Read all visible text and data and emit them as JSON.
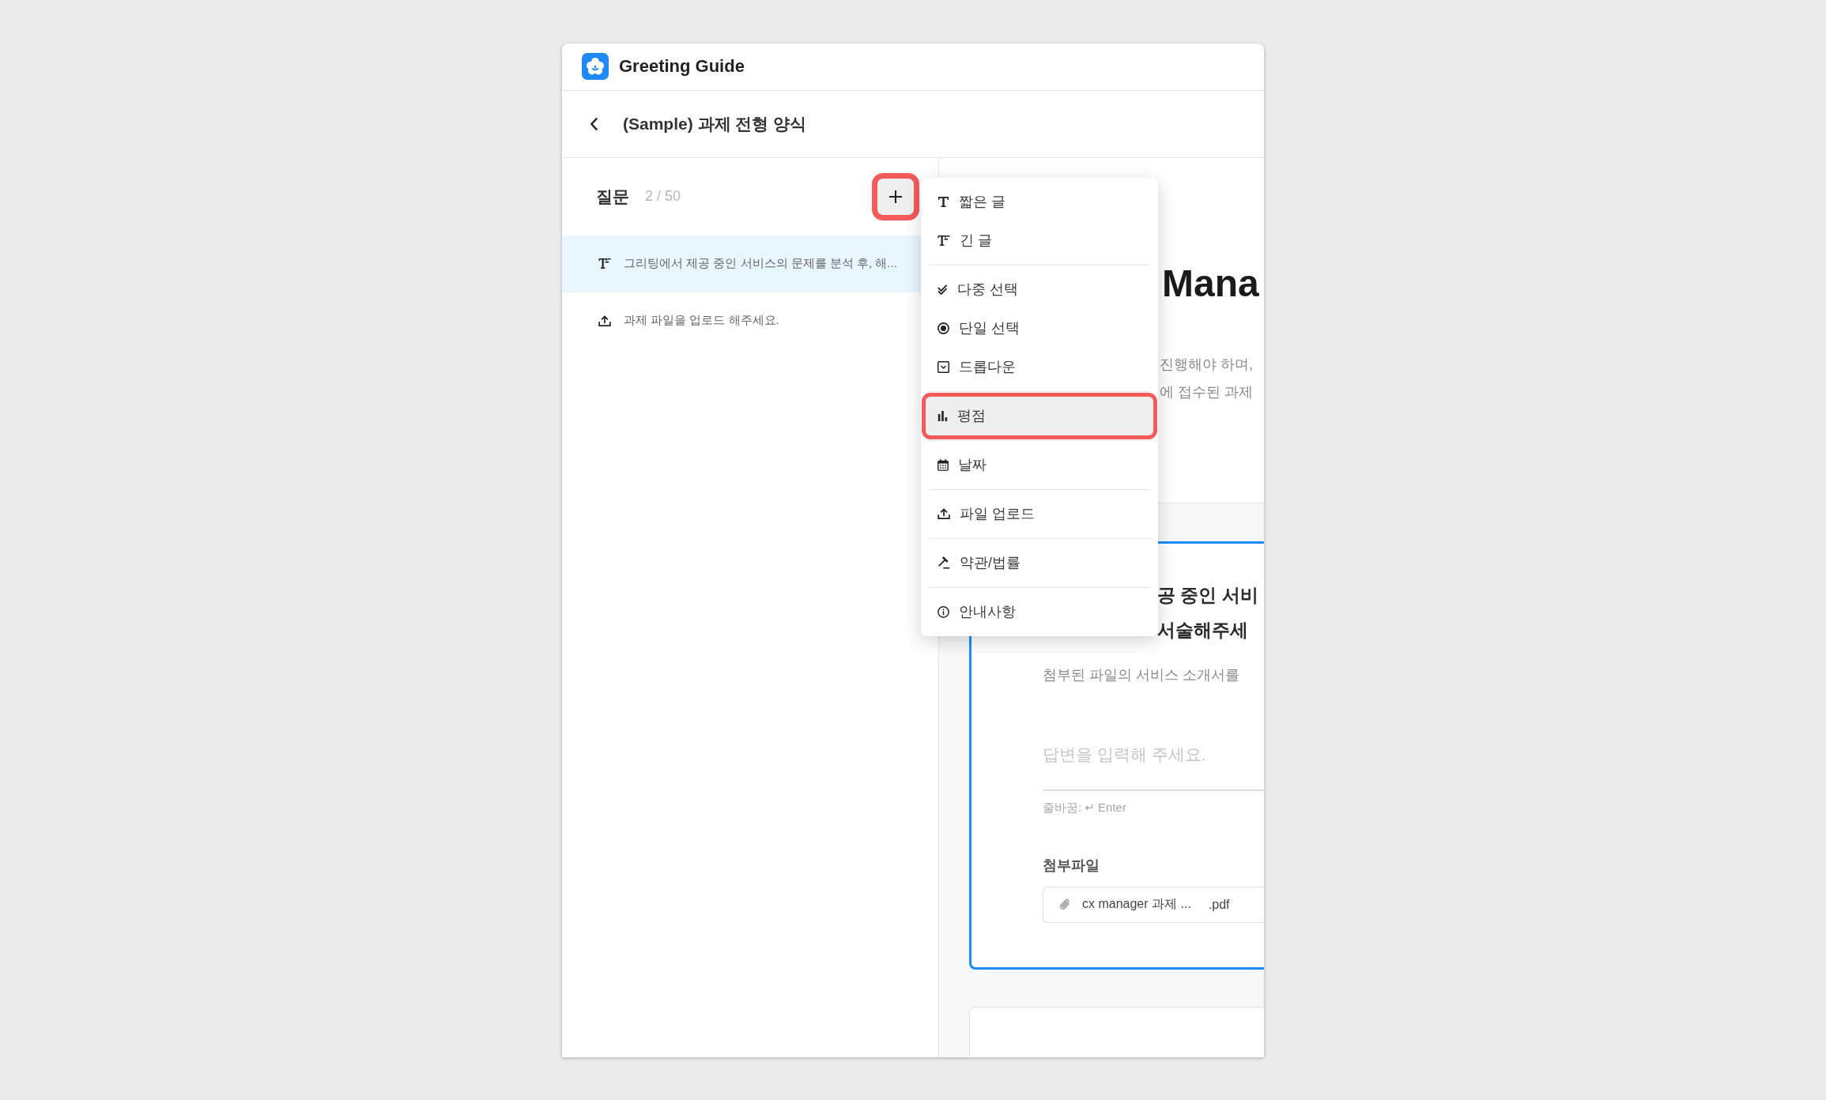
{
  "app": {
    "name": "Greeting Guide"
  },
  "page_header": {
    "title": "(Sample) 과제 전형 양식"
  },
  "question_panel": {
    "title": "질문",
    "count": "2 / 50",
    "add_button": {
      "highlighted": true
    },
    "questions": [
      {
        "kind": "long_text",
        "text": "그리팅에서 제공 중인 서비스의 문제를 분석 후, 해...",
        "selected": true
      },
      {
        "kind": "file_upload",
        "text": "과제 파일을 업로드 해주세요.",
        "selected": false
      }
    ]
  },
  "add_menu": {
    "groups": [
      {
        "items": [
          {
            "kind": "short_text",
            "label": "짧은 글",
            "highlighted": false
          },
          {
            "kind": "long_text",
            "label": "긴 글",
            "highlighted": false
          }
        ]
      },
      {
        "items": [
          {
            "kind": "multiple_choice",
            "label": "다중 선택",
            "highlighted": false
          },
          {
            "kind": "single_choice",
            "label": "단일 선택",
            "highlighted": false
          },
          {
            "kind": "dropdown",
            "label": "드롭다운",
            "highlighted": false
          }
        ]
      },
      {
        "items": [
          {
            "kind": "rating",
            "label": "평점",
            "highlighted": true
          }
        ]
      },
      {
        "items": [
          {
            "kind": "date",
            "label": "날짜",
            "highlighted": false
          }
        ]
      },
      {
        "items": [
          {
            "kind": "file_upload",
            "label": "파일 업로드",
            "highlighted": false
          }
        ]
      },
      {
        "items": [
          {
            "kind": "terms",
            "label": "약관/법률",
            "highlighted": false
          }
        ]
      },
      {
        "items": [
          {
            "kind": "notice",
            "label": "안내사항",
            "highlighted": false
          }
        ]
      }
    ]
  },
  "form_preview": {
    "title": "Mana",
    "description_lines": [
      "진행해야 하며,",
      "에 접수된 과제"
    ],
    "question_cards": [
      {
        "active": true,
        "title_lines": [
          "공 중인 서비",
          "서술해주세"
        ],
        "description": "첨부된 파일의 서비스 소개서를",
        "answer": {
          "placeholder": "답변을 입력해 주세요."
        },
        "hint": "줄바꿈: ↵ Enter",
        "attachments_label": "첨부파일",
        "attachment": {
          "name": "cx manager 과제 ...",
          "extension": ".pdf"
        }
      },
      {
        "active": false
      }
    ]
  }
}
